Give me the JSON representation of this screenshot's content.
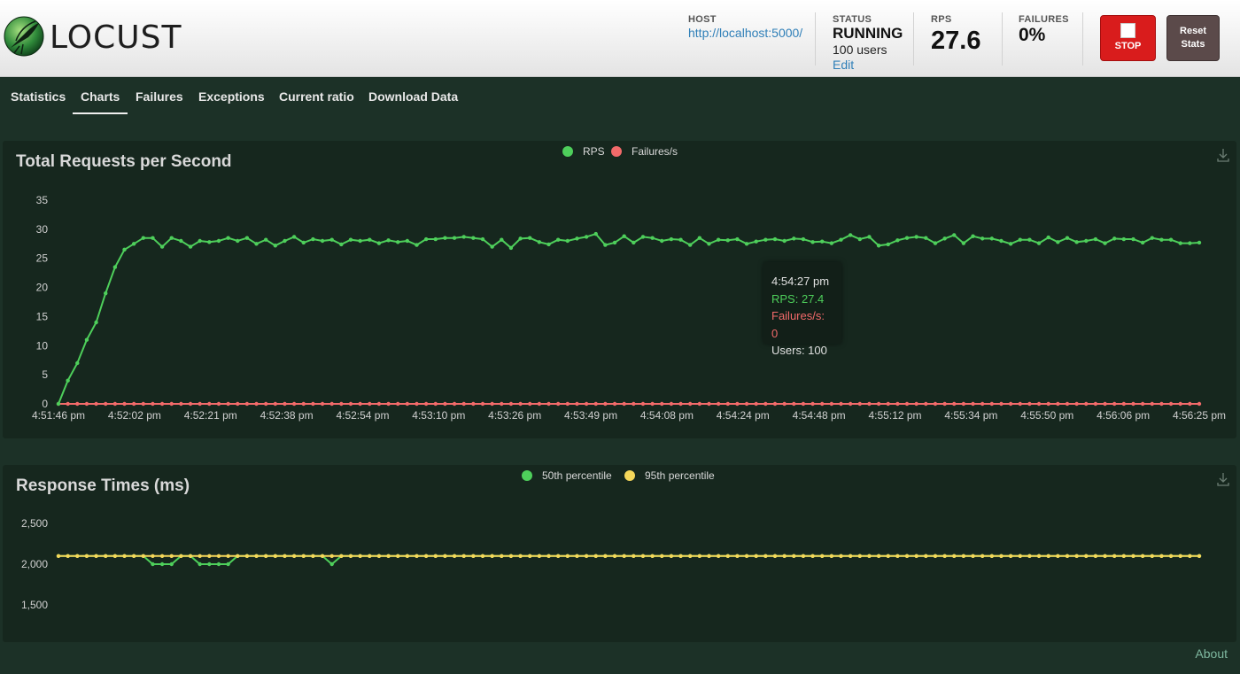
{
  "app": {
    "name": "LOCUST"
  },
  "header": {
    "host_label": "HOST",
    "host_value": "http://localhost:5000/",
    "status_label": "STATUS",
    "status_value": "RUNNING",
    "users_value": "100 users",
    "edit_label": "Edit",
    "rps_label": "RPS",
    "rps_value": "27.6",
    "failures_label": "FAILURES",
    "failures_value": "0%",
    "stop_label": "STOP",
    "reset_label_line1": "Reset",
    "reset_label_line2": "Stats"
  },
  "tabs": [
    {
      "label": "Statistics"
    },
    {
      "label": "Charts",
      "active": true
    },
    {
      "label": "Failures"
    },
    {
      "label": "Exceptions"
    },
    {
      "label": "Current ratio"
    },
    {
      "label": "Download Data"
    }
  ],
  "colors": {
    "rps": "#4ecf5b",
    "failures": "#f26a6a",
    "p50": "#4ecf5b",
    "p95": "#f5d75a",
    "accent": "#d91c1c"
  },
  "icons": {
    "logo": "locust-logo-icon",
    "download": "download-icon",
    "stop": "stop-square-icon"
  },
  "chart_data": [
    {
      "type": "line",
      "title": "Total Requests per Second",
      "legend_position": "top-center",
      "grid": false,
      "x_tick_labels": [
        "4:51:46 pm",
        "4:52:02 pm",
        "4:52:21 pm",
        "4:52:38 pm",
        "4:52:54 pm",
        "4:53:10 pm",
        "4:53:26 pm",
        "4:53:49 pm",
        "4:54:08 pm",
        "4:54:24 pm",
        "4:54:48 pm",
        "4:55:12 pm",
        "4:55:34 pm",
        "4:55:50 pm",
        "4:56:06 pm",
        "4:56:25 pm"
      ],
      "y_ticks": [
        0,
        5,
        10,
        15,
        20,
        25,
        30,
        35
      ],
      "ylim": [
        0,
        35
      ],
      "series": [
        {
          "name": "RPS",
          "values": [
            0,
            4,
            7,
            11,
            14,
            19,
            23.5,
            26.5,
            27.5,
            28.5,
            28.5,
            27,
            28.5,
            28,
            27,
            28,
            27.8,
            28,
            28.5,
            28,
            28.5,
            27.5,
            28.2,
            27.2,
            28,
            28.7,
            27.7,
            28.3,
            28,
            28.2,
            27.4,
            28.2,
            28,
            28.2,
            27.6,
            28.1,
            27.8,
            28,
            27.3,
            28.3,
            28.3,
            28.5,
            28.5,
            28.7,
            28.5,
            28.3,
            27,
            28.2,
            26.8,
            28.4,
            28.5,
            27.8,
            27.4,
            28.2,
            28,
            28.4,
            28.7,
            29.2,
            27.3,
            27.7,
            28.8,
            27.7,
            28.7,
            28.5,
            28,
            28.3,
            28.2,
            27.3,
            28.5,
            27.5,
            28.2,
            28.1,
            28.3,
            27.5,
            27.9,
            28.2,
            28.3,
            28,
            28.4,
            28.3,
            27.8,
            27.9,
            27.6,
            28.2,
            29,
            28.3,
            28.7,
            27.2,
            27.4,
            28.1,
            28.5,
            28.7,
            28.5,
            27.6,
            28.4,
            29,
            27.6,
            28.8,
            28.4,
            28.4,
            28,
            27.5,
            28.2,
            28.2,
            27.6,
            28.6,
            27.8,
            28.5,
            27.8,
            28,
            28.3,
            27.6,
            28.4,
            28.3,
            28.3,
            27.7,
            28.5,
            28.2,
            28.2,
            27.6,
            27.6,
            27.7
          ]
        },
        {
          "name": "Failures/s",
          "values": "constant 0"
        }
      ],
      "tooltip": {
        "time": "4:54:27 pm",
        "rps": "RPS: 27.4",
        "failures": "Failures/s: 0",
        "users": "Users: 100"
      }
    },
    {
      "type": "line",
      "title": "Response Times (ms)",
      "legend_position": "top-center",
      "grid": false,
      "y_tick_labels": [
        "2,500",
        "2,000",
        "1,500"
      ],
      "ylim": [
        1500,
        2500
      ],
      "series": [
        {
          "name": "50th percentile",
          "baseline": 2100,
          "dips": [
            {
              "index": 10,
              "value": 2000
            },
            {
              "index": 11,
              "value": 2000
            },
            {
              "index": 12,
              "value": 2000
            },
            {
              "index": 15,
              "value": 2000
            },
            {
              "index": 16,
              "value": 2000
            },
            {
              "index": 17,
              "value": 2000
            },
            {
              "index": 18,
              "value": 2000
            },
            {
              "index": 29,
              "value": 2000
            }
          ]
        },
        {
          "name": "95th percentile",
          "baseline": 2100
        }
      ]
    }
  ],
  "footer": {
    "about_label": "About"
  }
}
